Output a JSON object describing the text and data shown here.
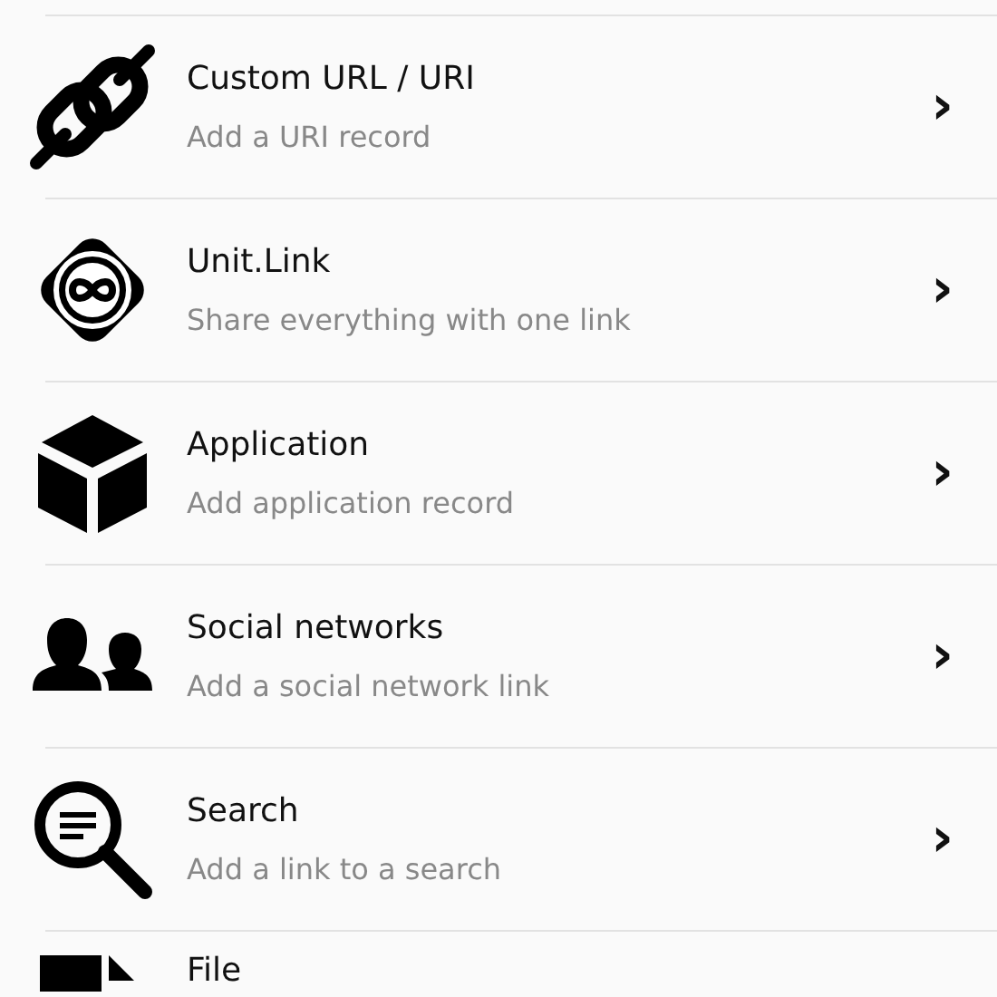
{
  "items": [
    {
      "title": "Custom URL / URI",
      "subtitle": "Add a URI record",
      "chevron": "›"
    },
    {
      "title": "Unit.Link",
      "subtitle": "Share everything with one link",
      "chevron": "›"
    },
    {
      "title": "Application",
      "subtitle": "Add application record",
      "chevron": "›"
    },
    {
      "title": "Social networks",
      "subtitle": "Add a social network link",
      "chevron": "›"
    },
    {
      "title": "Search",
      "subtitle": "Add a link to a search",
      "chevron": "›"
    },
    {
      "title": "File"
    }
  ]
}
